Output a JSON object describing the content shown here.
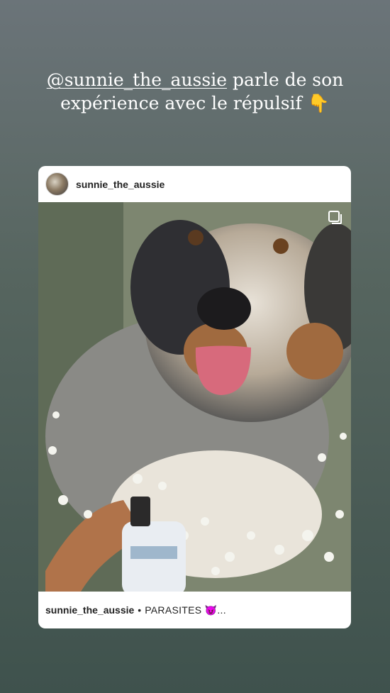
{
  "story": {
    "caption_mention": "@sunnie_the_aussie",
    "caption_text": "parle de son expérience avec le répulsif",
    "caption_emoji": "👇"
  },
  "post": {
    "username": "sunnie_the_aussie",
    "footer_username": "sunnie_the_aussie",
    "footer_separator": "•",
    "footer_caption": "PARASITES 😈...",
    "image_subject": "australian-shepherd-dog-in-flowers",
    "multiple_photos_icon": "multi-photo-icon"
  },
  "colors": {
    "background_top": "#6b7479",
    "background_bottom": "#3f524d",
    "card": "#ffffff",
    "text": "#222222"
  }
}
